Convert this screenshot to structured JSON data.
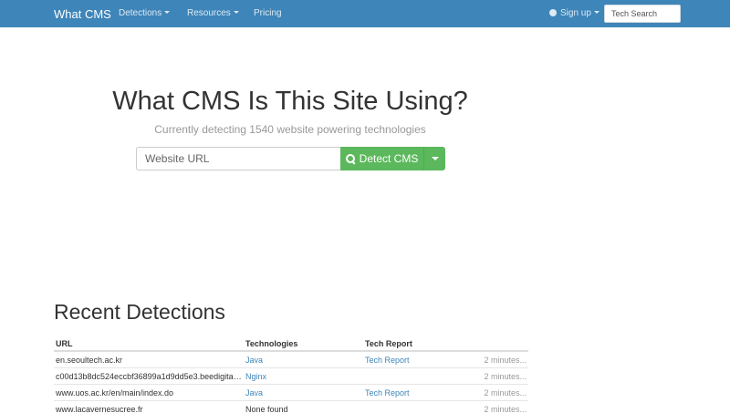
{
  "navbar": {
    "brand": "What CMS",
    "links": [
      {
        "label": "Detections",
        "dropdown": true
      },
      {
        "label": "Resources",
        "dropdown": true
      },
      {
        "label": "Pricing",
        "dropdown": false
      }
    ],
    "signup_label": "Sign up",
    "search_placeholder": "Tech Search"
  },
  "hero": {
    "title": "What CMS Is This Site Using?",
    "subtitle": "Currently detecting 1540 website powering technologies",
    "url_placeholder": "Website URL",
    "detect_label": "Detect CMS"
  },
  "recent": {
    "title": "Recent Detections",
    "columns": {
      "url": "URL",
      "technologies": "Technologies",
      "report": "Tech Report"
    },
    "rows": [
      {
        "url": "en.seoultech.ac.kr",
        "tech": "Java",
        "tech_linked": true,
        "report": "Tech Report",
        "time": "2 minutes..."
      },
      {
        "url": "c00d13b8dc524eccbf36899a1d9dd5e3.beedigital...",
        "tech": "Nginx",
        "tech_linked": true,
        "report": "",
        "time": "2 minutes..."
      },
      {
        "url": "www.uos.ac.kr/en/main/index.do",
        "tech": "Java",
        "tech_linked": true,
        "report": "Tech Report",
        "time": "2 minutes..."
      },
      {
        "url": "www.lacavernesucree.fr",
        "tech": "None found",
        "tech_linked": false,
        "report": "",
        "time": "2 minutes..."
      }
    ]
  },
  "colors": {
    "navbar": "#3e85b9",
    "button": "#5cb85c",
    "link": "#3e85b9"
  }
}
